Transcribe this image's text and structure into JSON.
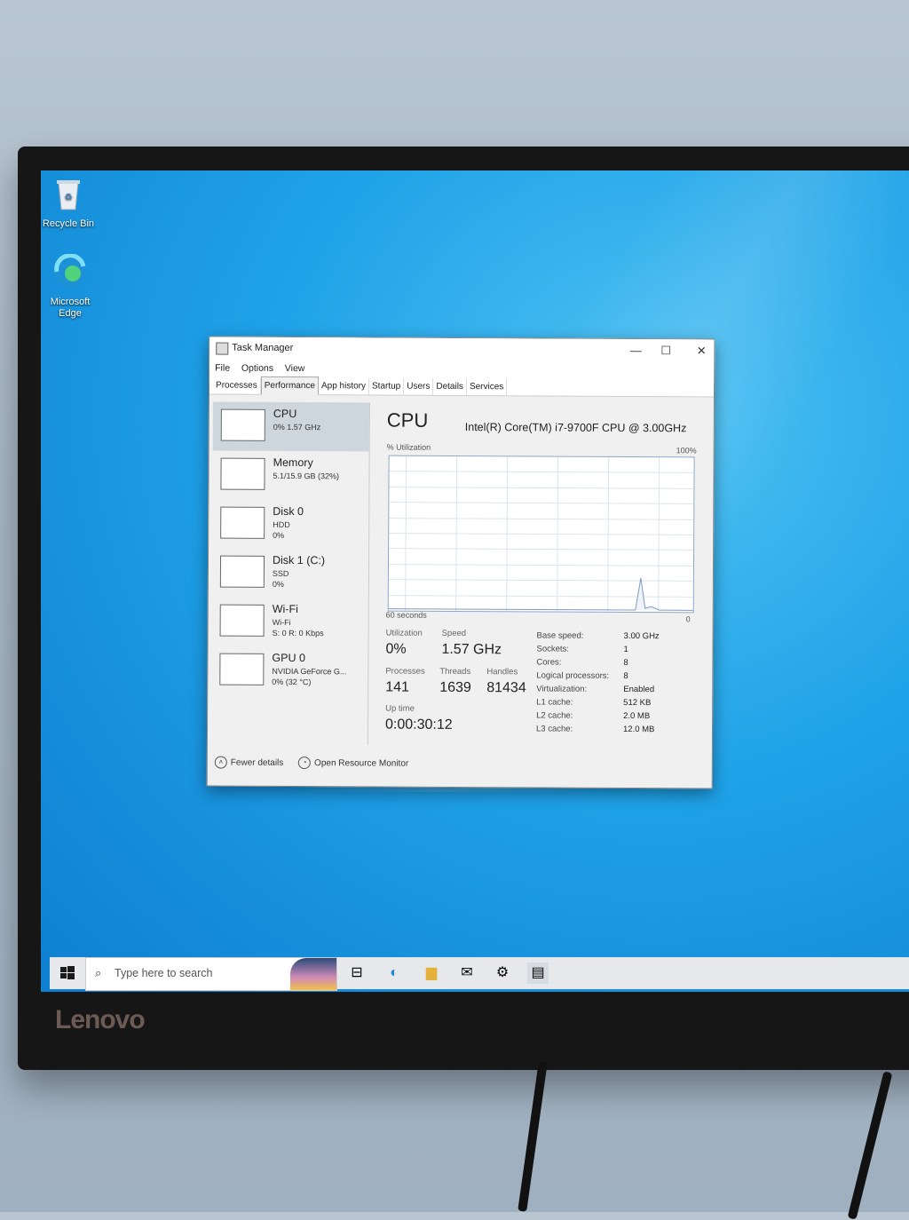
{
  "desktop": {
    "recycle_bin": "Recycle Bin",
    "edge": "Microsoft Edge"
  },
  "monitor": {
    "brand": "Lenovo"
  },
  "window": {
    "title": "Task Manager",
    "minimize": "—",
    "maximize": "☐",
    "close": "✕",
    "menu": [
      "File",
      "Options",
      "View"
    ],
    "tabs": [
      "Processes",
      "Performance",
      "App history",
      "Startup",
      "Users",
      "Details",
      "Services"
    ],
    "active_tab": "Performance"
  },
  "resources": [
    {
      "name": "CPU",
      "lines": [
        "0% 1.57 GHz"
      ]
    },
    {
      "name": "Memory",
      "lines": [
        "5.1/15.9 GB (32%)"
      ]
    },
    {
      "name": "Disk 0",
      "lines": [
        "HDD",
        "0%"
      ]
    },
    {
      "name": "Disk 1 (C:)",
      "lines": [
        "SSD",
        "0%"
      ]
    },
    {
      "name": "Wi-Fi",
      "lines": [
        "Wi-Fi",
        "S: 0 R: 0 Kbps"
      ]
    },
    {
      "name": "GPU 0",
      "lines": [
        "NVIDIA GeForce G...",
        "0% (32 °C)"
      ]
    }
  ],
  "cpu": {
    "heading": "CPU",
    "model": "Intel(R) Core(TM) i7-9700F CPU @ 3.00GHz",
    "util_label": "% Utilization",
    "max_label": "100%",
    "time_label": "60 seconds",
    "min_label": "0",
    "utilization_label": "Utilization",
    "utilization": "0%",
    "speed_label": "Speed",
    "speed": "1.57 GHz",
    "processes_label": "Processes",
    "processes": "141",
    "threads_label": "Threads",
    "threads": "1639",
    "handles_label": "Handles",
    "handles": "81434",
    "uptime_label": "Up time",
    "uptime": "0:00:30:12",
    "details": [
      {
        "k": "Base speed:",
        "v": "3.00 GHz"
      },
      {
        "k": "Sockets:",
        "v": "1"
      },
      {
        "k": "Cores:",
        "v": "8"
      },
      {
        "k": "Logical processors:",
        "v": "8"
      },
      {
        "k": "Virtualization:",
        "v": "Enabled"
      },
      {
        "k": "L1 cache:",
        "v": "512 KB"
      },
      {
        "k": "L2 cache:",
        "v": "2.0 MB"
      },
      {
        "k": "L3 cache:",
        "v": "12.0 MB"
      }
    ]
  },
  "footer": {
    "fewer": "Fewer details",
    "monitor": "Open Resource Monitor"
  },
  "taskbar": {
    "search_placeholder": "Type here to search",
    "icons": [
      "task-view-icon",
      "edge-icon",
      "file-explorer-icon",
      "mail-icon",
      "settings-icon",
      "task-manager-icon"
    ]
  }
}
